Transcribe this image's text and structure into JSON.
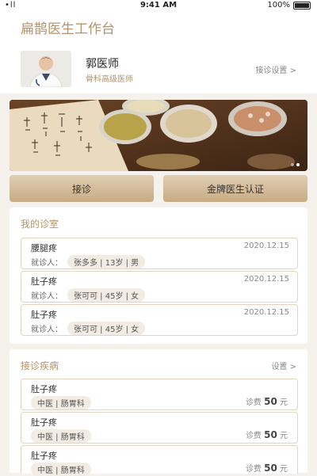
{
  "status_bar": {
    "signal": "•ll",
    "time": "9:41 AM",
    "battery": "100%"
  },
  "header": {
    "title": "扁鹊医生工作台"
  },
  "doctor": {
    "name": "郭医师",
    "title": "骨科高级医师",
    "settings_label": "接诊设置 >"
  },
  "buttons": {
    "consult": "接诊",
    "certification": "金牌医生认证"
  },
  "clinic": {
    "title": "我的诊室",
    "patient_label": "就诊人：",
    "cases": [
      {
        "complaint": "腰腿疼",
        "date": "2020.12.15",
        "patient": "张多多 | 13岁 | 男"
      },
      {
        "complaint": "肚子疼",
        "date": "2020.12.15",
        "patient": "张可可 | 45岁 | 女"
      },
      {
        "complaint": "肚子疼",
        "date": "2020.12.15",
        "patient": "张可可 | 45岁 | 女"
      }
    ]
  },
  "diseases": {
    "title": "接诊疾病",
    "settings_label": "设置 >",
    "fee_label": "诊费",
    "unit": "元",
    "items": [
      {
        "name": "肚子疼",
        "dept": "中医 | 肠胃科",
        "fee": "50"
      },
      {
        "name": "肚子疼",
        "dept": "中医 | 肠胃科",
        "fee": "50"
      },
      {
        "name": "肚子疼",
        "dept": "中医 | 肠胃科",
        "fee": "50"
      }
    ]
  }
}
